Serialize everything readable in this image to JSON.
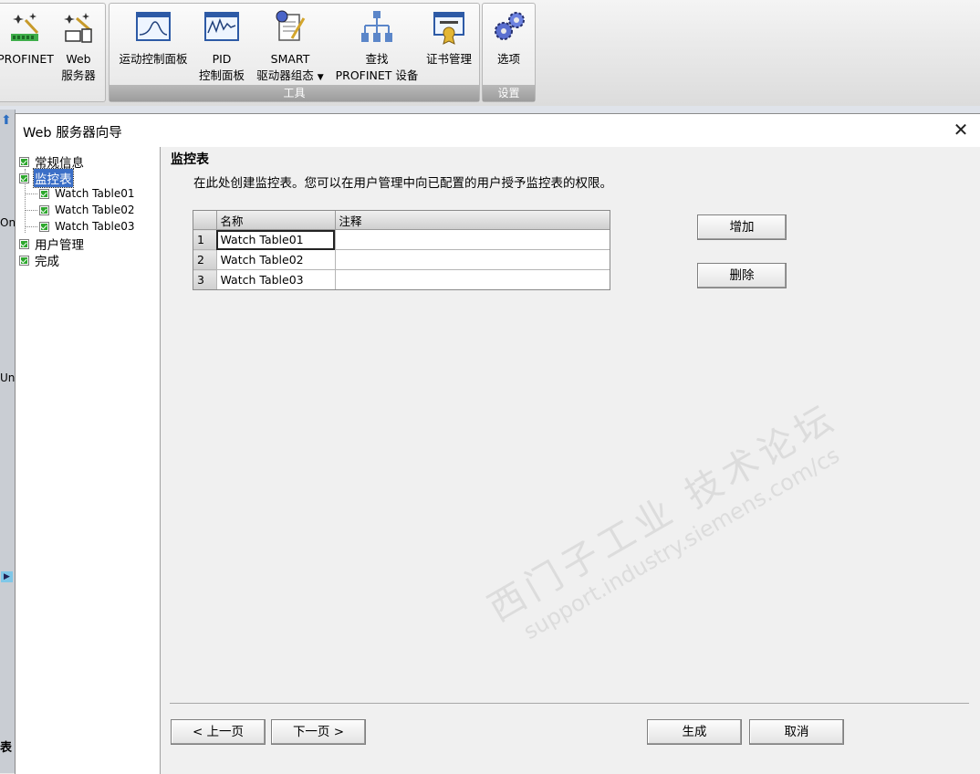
{
  "ribbon": {
    "buttons": [
      {
        "label1": "PROFINET",
        "label2": ""
      },
      {
        "label1": "Web",
        "label2": "服务器"
      },
      {
        "label1": "运动控制面板",
        "label2": ""
      },
      {
        "label1": "PID",
        "label2": "控制面板"
      },
      {
        "label1": "SMART",
        "label2": "驱动器组态"
      },
      {
        "label1": "查找",
        "label2": "PROFINET 设备"
      },
      {
        "label1": "证书管理",
        "label2": ""
      },
      {
        "label1": "选项",
        "label2": ""
      }
    ],
    "group_tools": "工具",
    "group_settings": "设置"
  },
  "left_fragments": {
    "on": "On",
    "un": "Un",
    "table": "表"
  },
  "dialog": {
    "title": "Web 服务器向导",
    "close": "✕"
  },
  "nav": {
    "items": [
      {
        "label": "常规信息"
      },
      {
        "label": "监控表"
      },
      {
        "label": "Watch Table01"
      },
      {
        "label": "Watch Table02"
      },
      {
        "label": "Watch Table03"
      },
      {
        "label": "用户管理"
      },
      {
        "label": "完成"
      }
    ]
  },
  "main": {
    "section_title": "监控表",
    "description": "在此处创建监控表。您可以在用户管理中向已配置的用户授予监控表的权限。",
    "table": {
      "headers": [
        "名称",
        "注释"
      ],
      "rows": [
        {
          "num": "1",
          "name": "Watch Table01",
          "comment": ""
        },
        {
          "num": "2",
          "name": "Watch Table02",
          "comment": ""
        },
        {
          "num": "3",
          "name": "Watch Table03",
          "comment": ""
        }
      ]
    },
    "add_button": "增加",
    "delete_button": "删除"
  },
  "footer": {
    "prev": "< 上一页",
    "next": "下一页 >",
    "generate": "生成",
    "cancel": "取消"
  },
  "watermark": {
    "text": "西门子工业 技术论坛",
    "url": "support.industry.siemens.com/cs"
  }
}
